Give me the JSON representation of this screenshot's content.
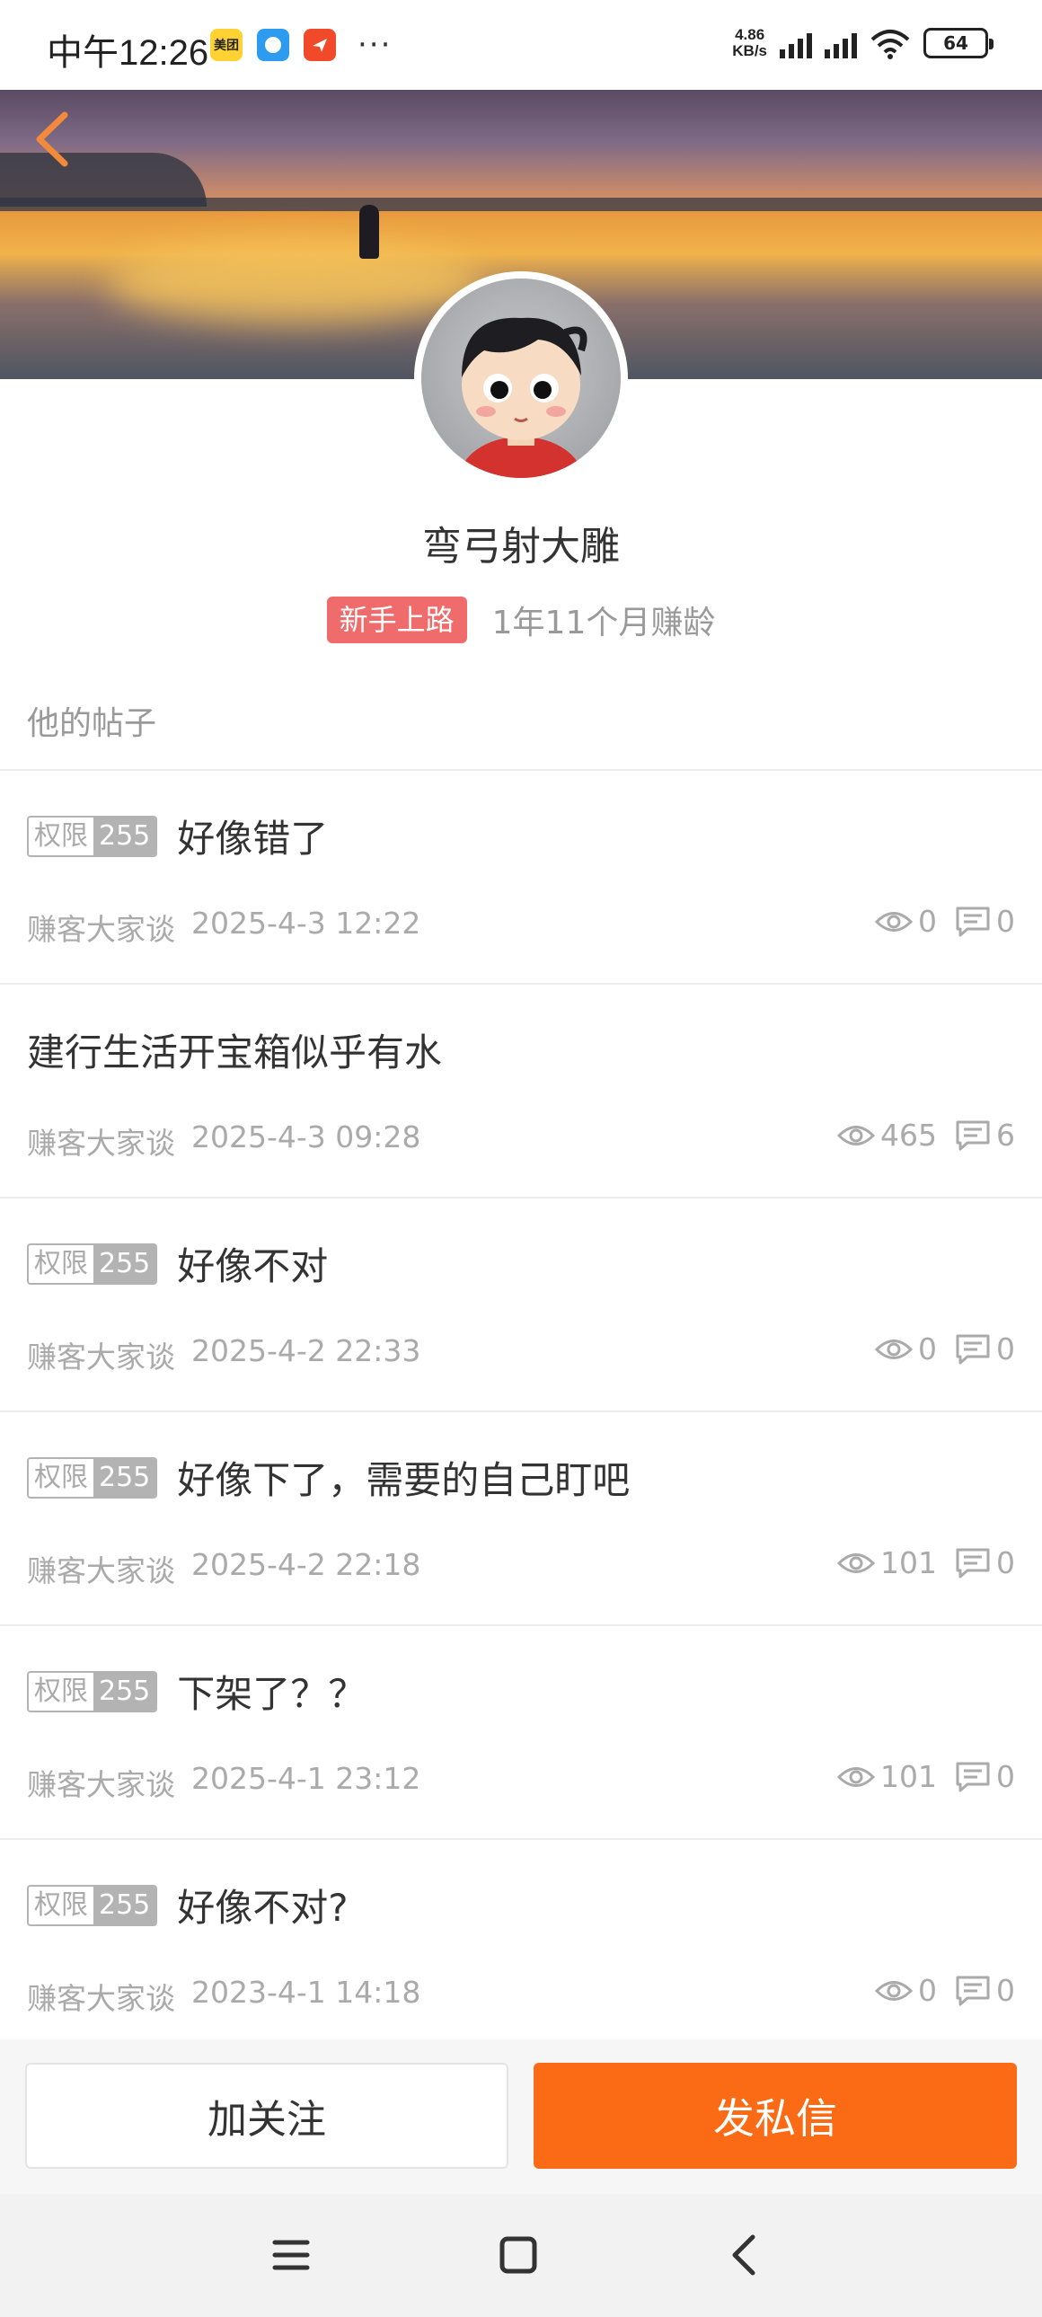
{
  "status_bar": {
    "time": "中午12:26",
    "apps": [
      "美团",
      "",
      ""
    ],
    "more": "···",
    "speed_top": "4.86",
    "speed_bottom": "KB/s",
    "battery": "64"
  },
  "profile": {
    "username": "弯弓射大雕",
    "level_badge": "新手上路",
    "account_age": "1年11个月赚龄"
  },
  "section": {
    "title": "他的帖子"
  },
  "posts": [
    {
      "perm_key": "权限",
      "perm_val": "255",
      "title": "好像错了",
      "board": "赚客大家谈",
      "time": "2025-4-3 12:22",
      "views": "0",
      "comments": "0"
    },
    {
      "perm_key": "",
      "perm_val": "",
      "title": "建行生活开宝箱似乎有水",
      "board": "赚客大家谈",
      "time": "2025-4-3 09:28",
      "views": "465",
      "comments": "6"
    },
    {
      "perm_key": "权限",
      "perm_val": "255",
      "title": "好像不对",
      "board": "赚客大家谈",
      "time": "2025-4-2 22:33",
      "views": "0",
      "comments": "0"
    },
    {
      "perm_key": "权限",
      "perm_val": "255",
      "title": "好像下了，需要的自己盯吧",
      "board": "赚客大家谈",
      "time": "2025-4-2 22:18",
      "views": "101",
      "comments": "0"
    },
    {
      "perm_key": "权限",
      "perm_val": "255",
      "title": "下架了？？",
      "board": "赚客大家谈",
      "time": "2025-4-1 23:12",
      "views": "101",
      "comments": "0"
    },
    {
      "perm_key": "权限",
      "perm_val": "255",
      "title": "好像不对?",
      "board": "赚客大家谈",
      "time": "2023-4-1 14:18",
      "views": "0",
      "comments": "0"
    }
  ],
  "actions": {
    "follow_label": "加关注",
    "message_label": "发私信"
  },
  "colors": {
    "accent": "#fb6a14",
    "badge": "#f06b6b",
    "muted": "#aaaaaa"
  },
  "icons": {
    "back": "chevron-left-icon",
    "views": "eye-icon",
    "comments": "comment-icon",
    "nav_menu": "menu-icon",
    "nav_home": "square-icon",
    "nav_back": "back-arrow-icon"
  }
}
